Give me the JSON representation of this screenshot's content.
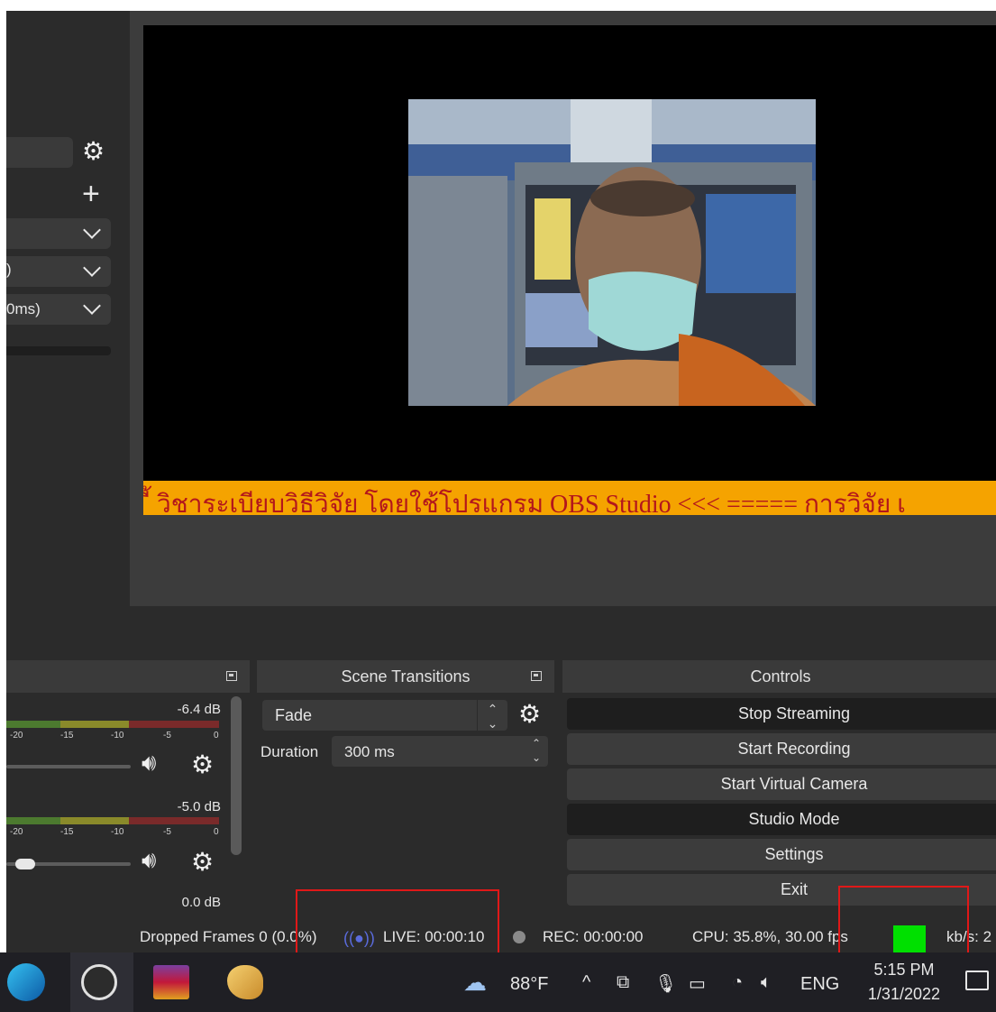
{
  "left_panel": {
    "dropdown_2_value": ")",
    "dropdown_3_value": "0ms)"
  },
  "preview": {
    "ticker_text": "ี้ วิชาระเบียบวิธีวิจัย โดยใช้โปรแกรม OBS Studio  <<< ===== การวิจัย เ"
  },
  "mixer": {
    "channels": [
      {
        "db": "-6.4 dB",
        "ticks": [
          "-20",
          "-15",
          "-10",
          "-5",
          "0"
        ]
      },
      {
        "db": "-5.0 dB",
        "ticks": [
          "-20",
          "-15",
          "-10",
          "-5",
          "0"
        ]
      }
    ],
    "third_db": "0.0 dB",
    "volume_levels": [
      0.0,
      0.07
    ]
  },
  "transitions": {
    "title": "Scene Transitions",
    "selected": "Fade",
    "duration_label": "Duration",
    "duration_value": "300 ms"
  },
  "controls": {
    "title": "Controls",
    "buttons": [
      "Stop Streaming",
      "Start Recording",
      "Start Virtual Camera",
      "Studio Mode",
      "Settings",
      "Exit"
    ]
  },
  "statusbar": {
    "dropped": "Dropped Frames 0 (0.0%)",
    "live": "LIVE: 00:00:10",
    "rec": "REC: 00:00:00",
    "cpu": "CPU: 35.8%, 30.00 fps",
    "kbps": "kb/s: 2",
    "health_color": "#00e000"
  },
  "taskbar": {
    "weather": "88°F",
    "lang": "ENG",
    "time": "5:15 PM",
    "date": "1/31/2022"
  }
}
